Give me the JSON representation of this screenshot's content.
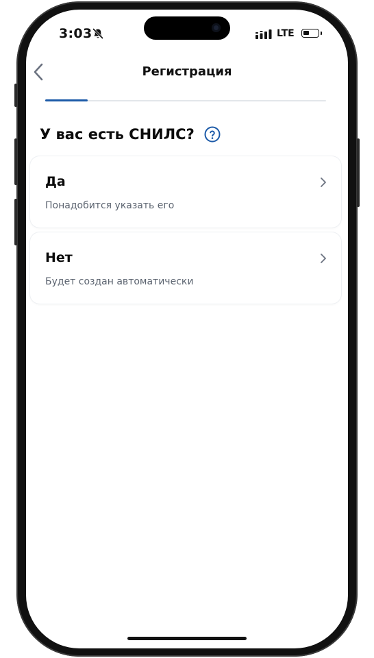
{
  "status_bar": {
    "time": "3:03",
    "mute_icon": "bell-slash-icon",
    "network": "LTE",
    "signal_icon": "cellular-signal-icon",
    "battery_icon": "battery-icon"
  },
  "nav": {
    "title": "Регистрация",
    "back_icon": "chevron-left-icon"
  },
  "progress": {
    "fraction": 0.15,
    "color": "#1c5aa8"
  },
  "question": {
    "text": "У вас есть СНИЛС?",
    "help_icon": "question-circle-icon",
    "help_color": "#1c5aa8"
  },
  "options": [
    {
      "title": "Да",
      "subtitle": "Понадобится указать его"
    },
    {
      "title": "Нет",
      "subtitle": "Будет создан автоматически"
    }
  ]
}
